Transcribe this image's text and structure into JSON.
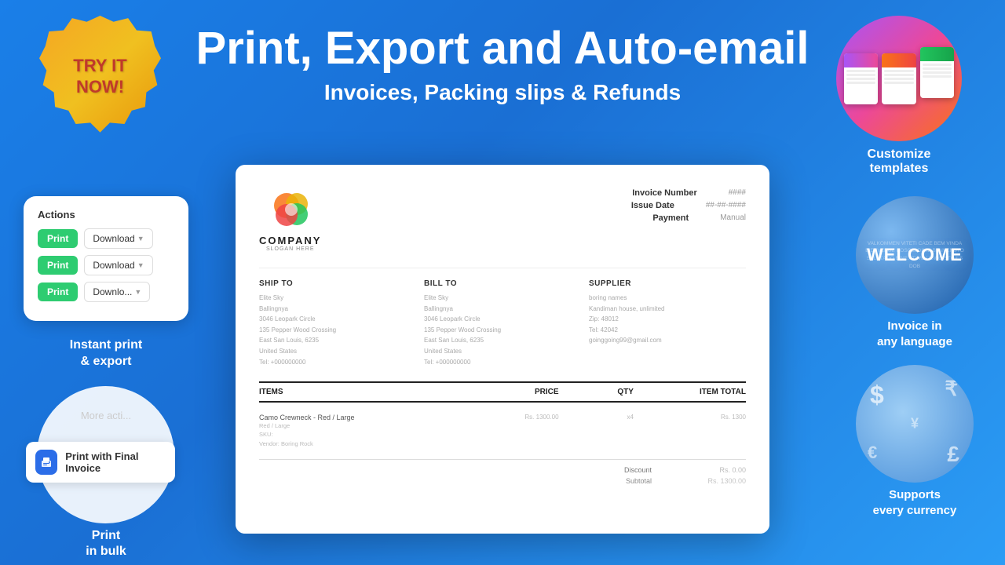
{
  "badge": {
    "line1": "TRY IT",
    "line2": "NOW!"
  },
  "headline": {
    "title": "Print, Export and Auto-email",
    "subtitle": "Invoices, Packing slips & Refunds"
  },
  "actions": {
    "title": "Actions",
    "rows": [
      {
        "print": "Print",
        "download": "Download"
      },
      {
        "print": "Print",
        "download": "Download"
      },
      {
        "print": "Print",
        "download": "Download"
      }
    ]
  },
  "instant_print": {
    "line1": "Instant print",
    "line2": "& export"
  },
  "more_actions": {
    "placeholder": "More acti...",
    "print_final": "Print with Final Invoice"
  },
  "print_bulk": {
    "line1": "Print",
    "line2": "in bulk"
  },
  "invoice": {
    "company": "COMPANY",
    "slogan": "SLOGAN HERE",
    "invoice_number_label": "Invoice Number",
    "invoice_number_val": "####",
    "issue_date_label": "Issue Date",
    "issue_date_val": "##-##-####",
    "payment_label": "Payment",
    "payment_val": "Manual",
    "ship_to": "SHIP TO",
    "bill_to": "BILL TO",
    "supplier": "SUPPLIER",
    "columns": {
      "items": "ITEMS",
      "price": "PRICE",
      "qty": "QTY",
      "item_total": "ITEM TOTAL"
    },
    "items": [
      {
        "name": "Camo Crewneck - Red / Large",
        "sub1": "Red / Large",
        "sub2": "SKU:",
        "sub3": "Vendor: Boring Rock",
        "price": "Rs. 1300.00",
        "qty": "x4",
        "total": "Rs. 1300"
      }
    ],
    "discount_label": "Discount",
    "discount_val": "Rs. 0.00",
    "subtotal_label": "Subtotal",
    "subtotal_val": "Rs. 1300.00"
  },
  "customize_templates": {
    "label_line1": "Customize",
    "label_line2": "templates"
  },
  "invoice_language": {
    "center": "WELCOME",
    "label_line1": "Invoice in",
    "label_line2": "any language"
  },
  "currency": {
    "label_line1": "Supports",
    "label_line2": "every currency"
  }
}
